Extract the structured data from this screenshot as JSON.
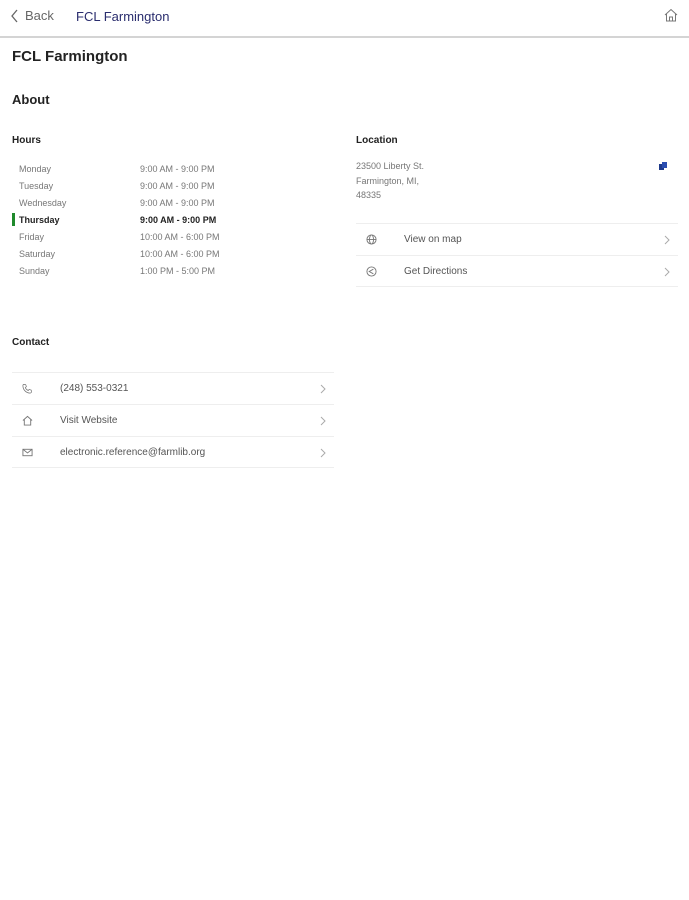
{
  "nav": {
    "back_label": "Back",
    "title": "FCL Farmington"
  },
  "page_title": "FCL Farmington",
  "about_heading": "About",
  "hours": {
    "heading": "Hours",
    "rows": [
      {
        "day": "Monday",
        "time": "9:00 AM - 9:00 PM"
      },
      {
        "day": "Tuesday",
        "time": "9:00 AM - 9:00 PM"
      },
      {
        "day": "Wednesday",
        "time": "9:00 AM - 9:00 PM"
      },
      {
        "day": "Thursday",
        "time": "9:00 AM - 9:00 PM",
        "today": true
      },
      {
        "day": "Friday",
        "time": "10:00 AM - 6:00 PM"
      },
      {
        "day": "Saturday",
        "time": "10:00 AM - 6:00 PM"
      },
      {
        "day": "Sunday",
        "time": "1:00 PM - 5:00 PM"
      }
    ]
  },
  "location": {
    "heading": "Location",
    "address": [
      "23500 Liberty St.",
      "Farmington, MI,",
      "48335"
    ],
    "actions": [
      {
        "label": "View on map",
        "icon": "globe-icon"
      },
      {
        "label": "Get Directions",
        "icon": "directions-icon"
      }
    ]
  },
  "contact": {
    "heading": "Contact",
    "items": [
      {
        "label": "(248) 553-0321",
        "icon": "phone-icon"
      },
      {
        "label": "Visit Website",
        "icon": "home-icon"
      },
      {
        "label": "electronic.reference@farmlib.org",
        "icon": "mail-icon"
      }
    ]
  },
  "colors": {
    "accent": "#2a2d6e",
    "today": "#1f8a2c"
  }
}
